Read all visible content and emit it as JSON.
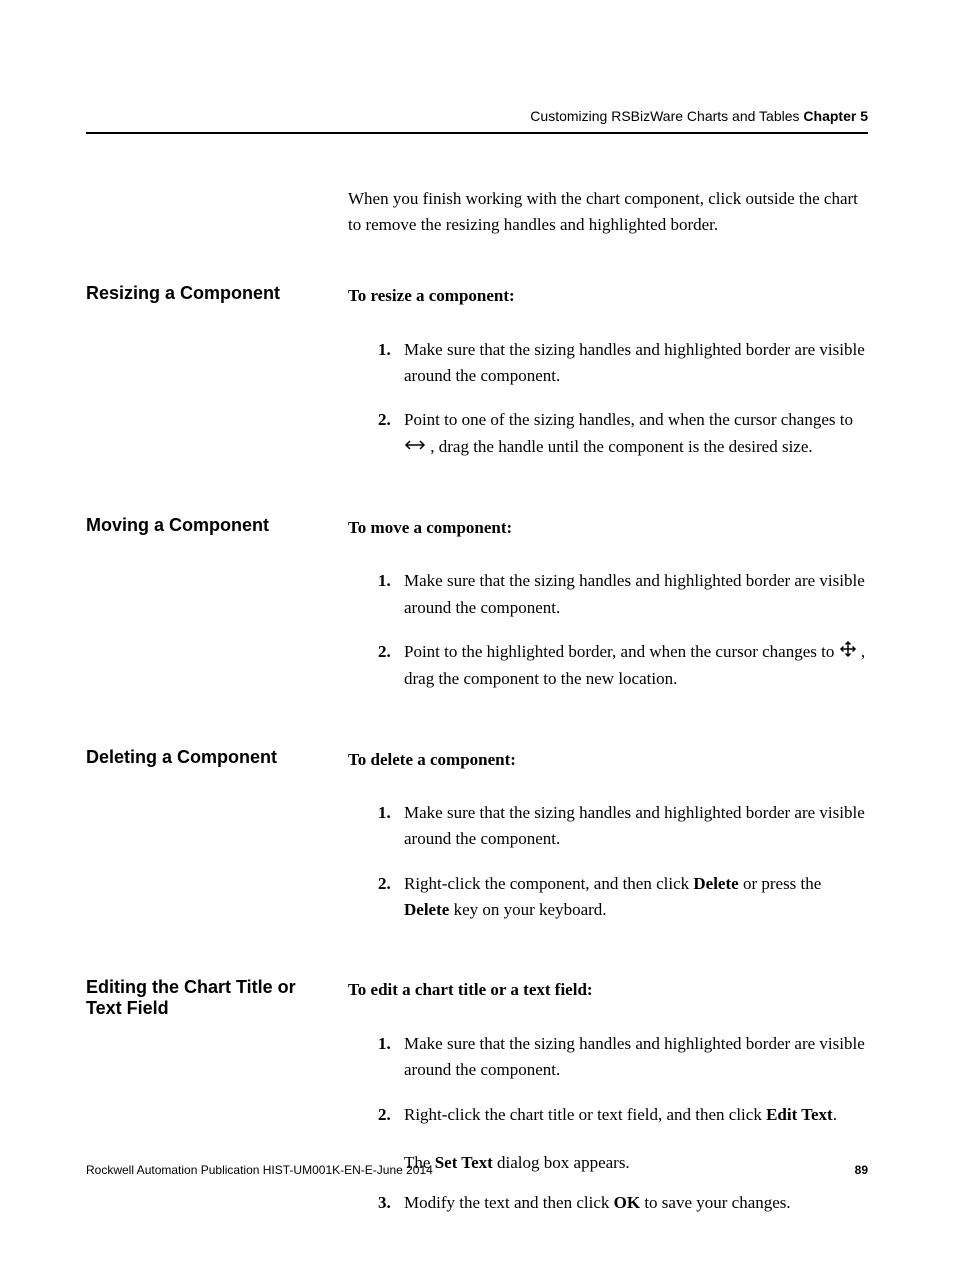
{
  "header": {
    "title": "Customizing RSBizWare Charts and Tables",
    "chapter": "Chapter 5"
  },
  "intro": "When you finish working with the chart component, click outside the chart to remove the resizing handles and highlighted border.",
  "sections": {
    "resize": {
      "heading": "Resizing a Component",
      "lead": "To resize a component:",
      "step1": "Make sure that the sizing handles and highlighted border are visible around the component.",
      "step2a": "Point to one of the sizing handles, and when the cursor changes to ",
      "step2b": ", drag the handle until the component is the desired size."
    },
    "move": {
      "heading": "Moving a Component",
      "lead": "To move a component:",
      "step1": "Make sure that the sizing handles and highlighted border are visible around the component.",
      "step2a": "Point to the highlighted border, and when the cursor changes to ",
      "step2b": ", drag the component to the new location."
    },
    "delete": {
      "heading": "Deleting a Component",
      "lead": "To delete a component:",
      "step1": "Make sure that the sizing handles and highlighted border are visible around the component.",
      "step2a": "Right-click the component, and then click ",
      "step2_delete": "Delete",
      "step2b": " or press the ",
      "step2_delete2": "Delete",
      "step2c": " key on your keyboard."
    },
    "edit": {
      "heading": "Editing the Chart Title or Text Field",
      "lead": "To edit a chart title or a text field:",
      "step1": "Make sure that the sizing handles and highlighted border are visible around the component.",
      "step2a": "Right-click the chart title or text field, and then click ",
      "step2_edit": "Edit Text",
      "step2b": ".",
      "followup_a": "The ",
      "followup_b": "Set Text",
      "followup_c": " dialog box appears.",
      "step3a": "Modify the text and then click ",
      "step3_ok": "OK",
      "step3b": " to save your changes."
    }
  },
  "footer": {
    "pub": "Rockwell Automation Publication HIST-UM001K-EN-E-June 2014",
    "page": "89"
  }
}
